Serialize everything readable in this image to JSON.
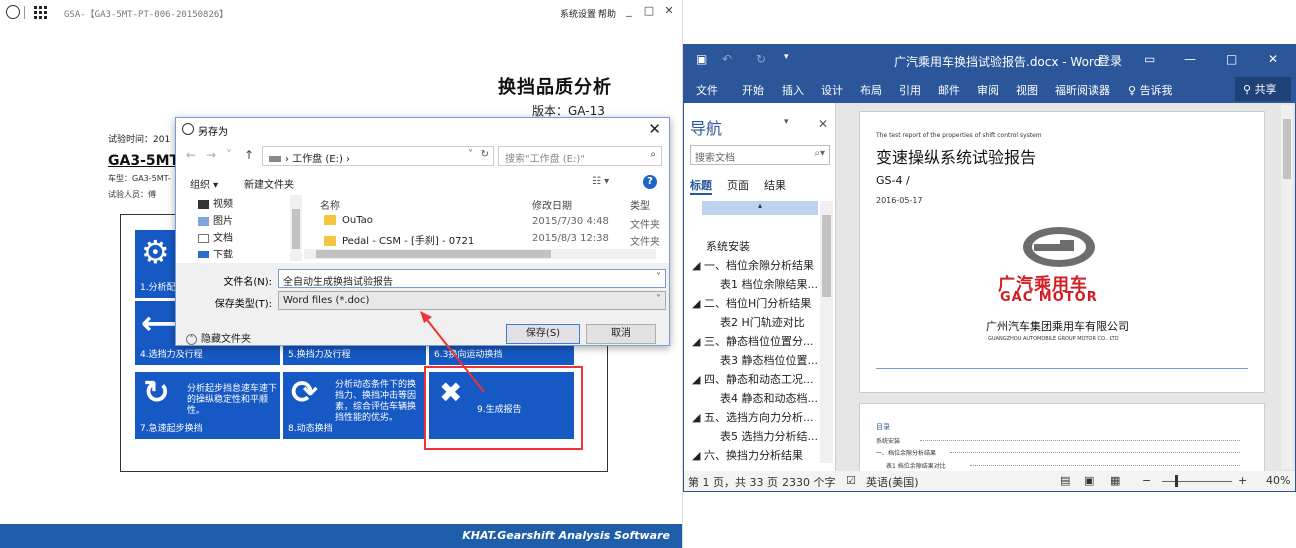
{
  "left_app": {
    "doc_title": "GSA-【GA3-5MT-PT-006-20150826】",
    "menu_settings": "系统设置",
    "menu_help": "帮助",
    "win_min": "_",
    "win_max": "□",
    "win_close": "✕",
    "report_title": "换挡品质分析",
    "version": "版本：GA-13",
    "meta_date": "试验时间：201",
    "meta_model": "GA3-5MT",
    "meta_car": "车型：GA3-5MT-",
    "meta_person": "试验人员：傅",
    "tiles": [
      {
        "label": "1.分析配",
        "desc": "",
        "icon": "⚙"
      },
      {
        "label": "4.选挡力及行程",
        "desc": "",
        "icon": "⟵"
      },
      {
        "label": "5.换挡力及行程",
        "desc": "",
        "icon": ""
      },
      {
        "label": "6.3换向运动换挡",
        "desc": "",
        "icon": ""
      },
      {
        "label": "7.急速起步换挡",
        "desc": "分析起步挡怠速车速下的操纵稳定性和平顺性。",
        "icon": "↻"
      },
      {
        "label": "8.动态换挡",
        "desc": "分析动态条件下的换挡力、换挡冲击等因素，综合评估车辆换挡性能的优劣。",
        "icon": "⟳"
      },
      {
        "label": "9.生成报告",
        "desc": "",
        "icon": "✖"
      }
    ],
    "footer_brand": "KHAT.Gearshift Analysis Software"
  },
  "save_dialog": {
    "title": "另存为",
    "close": "✕",
    "address_path": "› 工作盘 (E:) ›",
    "search_placeholder": "搜索\"工作盘 (E:)\"",
    "organize": "组织 ▾",
    "new_folder": "新建文件夹",
    "view_icon": "☷ ▾",
    "help": "?",
    "tree": [
      "视频",
      "图片",
      "文档",
      "下载"
    ],
    "columns": {
      "name": "名称",
      "date": "修改日期",
      "type": "类型"
    },
    "files": [
      {
        "name": "OuTao",
        "date": "2015/7/30 4:48",
        "type": "文件夹"
      },
      {
        "name": "Pedal - CSM - [手刹] - 0721",
        "date": "2015/8/3 12:38",
        "type": "文件夹"
      }
    ],
    "filename_label": "文件名(N):",
    "filename_value": "全自动生成换挡试验报告",
    "filetype_label": "保存类型(T):",
    "filetype_value": "Word files   (*.doc)",
    "hide_folders": "隐藏文件夹",
    "save_btn": "保存(S)",
    "cancel_btn": "取消"
  },
  "word": {
    "title": "广汽乘用车换挡试验报告.docx - Word",
    "login": "登录",
    "ribbon_tabs": [
      "文件",
      "开始",
      "插入",
      "设计",
      "布局",
      "引用",
      "邮件",
      "审阅",
      "视图",
      "福昕阅读器",
      "告诉我"
    ],
    "share": "共享",
    "nav": {
      "heading": "导航",
      "search_placeholder": "搜索文档",
      "tabs": [
        "标题",
        "页面",
        "结果"
      ],
      "items": [
        {
          "text": "系统安装",
          "level": 0
        },
        {
          "text": "◢ 一、档位余隙分析结果",
          "level": 0
        },
        {
          "text": "表1 档位余隙结果...",
          "level": 1
        },
        {
          "text": "◢ 二、档位H门分析结果",
          "level": 0
        },
        {
          "text": "表2 H门轨迹对比",
          "level": 1
        },
        {
          "text": "◢ 三、静态档位位置分...",
          "level": 0
        },
        {
          "text": "表3 静态档位位置...",
          "level": 1
        },
        {
          "text": "◢ 四、静态和动态工况...",
          "level": 0
        },
        {
          "text": "表4 静态和动态档...",
          "level": 1
        },
        {
          "text": "◢ 五、选挡方向力分析...",
          "level": 0
        },
        {
          "text": "表5 选挡力分析结...",
          "level": 1
        },
        {
          "text": "◢ 六、换挡力分析结果",
          "level": 0
        }
      ]
    },
    "page1": {
      "small_header": "The test report of the properties of shift control system",
      "main_title": "变速操纵系统试验报告",
      "code": "GS-4 /",
      "date": "2016-05-17",
      "logo_cn": "广汽乘用车",
      "logo_en": "GAC MOTOR",
      "company_cn": "广州汽车集团乘用车有限公司",
      "company_en": "GUANGZHOU AUTOMOBILE GROUP MOTOR CO., LTD"
    },
    "page2": {
      "toc_title": "目录",
      "toc_line1": "系统安装",
      "toc_line2": "一、档位余隙分析结果",
      "toc_line3": "表1 档位余隙结果对比"
    },
    "status": {
      "page": "第 1 页，共 33 页",
      "words": "2330 个字",
      "lang": "英语(美国)",
      "zoom": "40%"
    }
  }
}
